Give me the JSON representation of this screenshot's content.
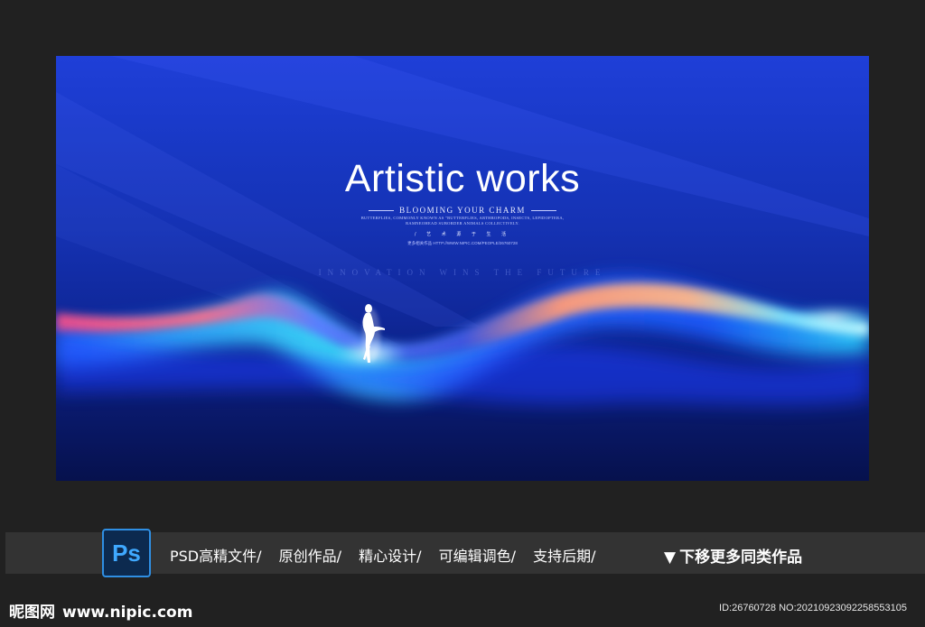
{
  "poster": {
    "headline": "Artistic works",
    "tagline": "BLOOMING YOUR CHARM",
    "small_lines": [
      "BUTTERFLIES, COMMONLY KNOWN AS \"BUTTERFLIES, ARTHROPODS, INSECTS, LEPIDOPTERA,",
      "RAMNEOHEAD SUBORDER ANIMALS COLLECTIVELY."
    ],
    "chinese_spaced": "/ 艺 术 源 于 生 活",
    "tiny_url": "更多相关作品 HTTP://WWW.NIPIC.COM/PEOPLE/26760728",
    "innovation": "INNOVATION WINS THE FUTURE",
    "colors": {
      "top_blue": "#1f3fd8",
      "bottom_navy": "#06114d",
      "wave_pink": "#ff5a8a",
      "wave_orange": "#ffb07a",
      "wave_cyan": "#4ff0ff"
    },
    "figure_icon": "woman-silhouette-icon"
  },
  "footer": {
    "ps_label": "Ps",
    "features": [
      "PSD高精文件/",
      "原创作品/",
      "精心设计/",
      "可编辑调色/",
      "支持后期/"
    ],
    "more_arrow": "▼",
    "more_label": "下移更多同类作品",
    "brand_cn": "昵图网",
    "brand_url": "www.nipic.com",
    "id_line": "ID:26760728 NO:20210923092258553105"
  }
}
